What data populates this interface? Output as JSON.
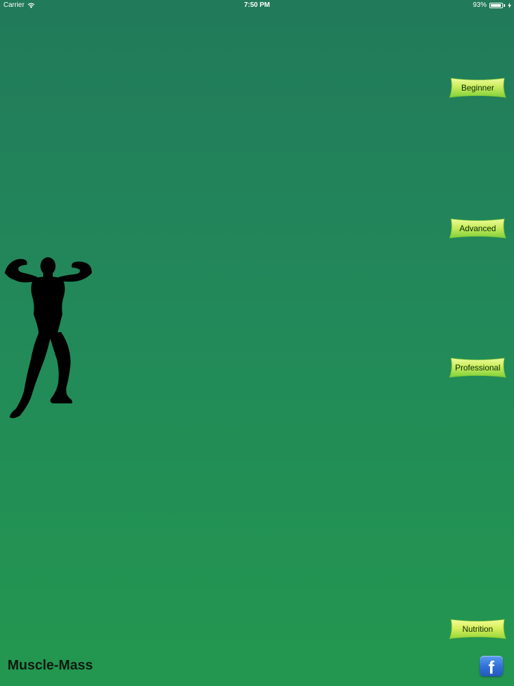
{
  "status_bar": {
    "carrier": "Carrier",
    "wifi_icon": "wifi-icon",
    "time": "7:50 PM",
    "battery_percent": "93%",
    "battery_level": 0.93,
    "charging_icon": "bolt-icon"
  },
  "menu": {
    "beginner_label": "Beginner",
    "advanced_label": "Advanced",
    "professional_label": "Professional",
    "nutrition_label": "Nutrition"
  },
  "app": {
    "title": "Muscle-Mass",
    "facebook_glyph": "f",
    "facebook_icon": "facebook-icon",
    "figure_icon": "bodybuilder-silhouette-icon"
  },
  "colors": {
    "background_top": "#217a5a",
    "background_bottom": "#23974f",
    "button_fill_top": "#d8f06a",
    "button_fill_bottom": "#7ed33a",
    "facebook_blue": "#2f6fd6"
  }
}
